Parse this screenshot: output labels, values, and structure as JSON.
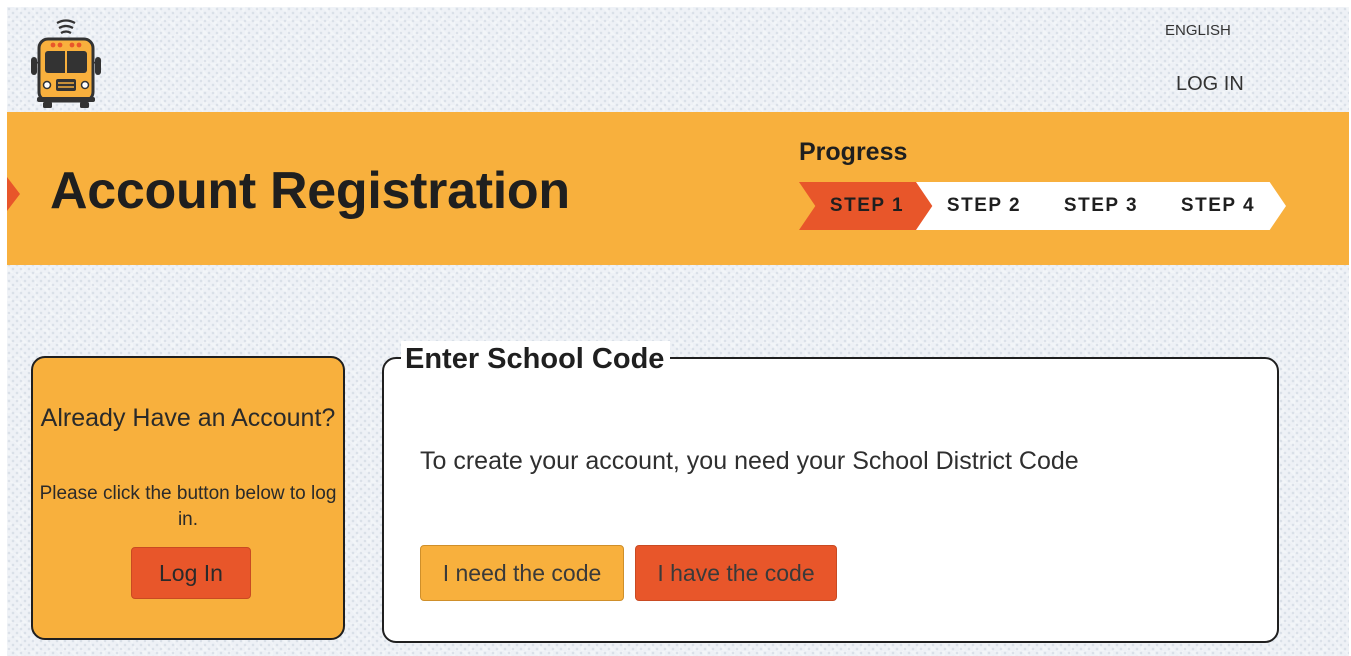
{
  "header": {
    "logo_icon": "school-bus-icon",
    "language_label": "ENGLISH",
    "login_label": "LOG IN"
  },
  "banner": {
    "title": "Account Registration",
    "progress_label": "Progress",
    "current_step": 1,
    "steps": [
      {
        "label": "STEP 1"
      },
      {
        "label": "STEP 2"
      },
      {
        "label": "STEP 3"
      },
      {
        "label": "STEP 4"
      }
    ]
  },
  "login_card": {
    "title": "Already Have an Account?",
    "text": "Please click the button below to log in.",
    "button_label": "Log In"
  },
  "code_panel": {
    "legend": "Enter School Code",
    "description": "To create your account, you need your School District Code",
    "need_code_label": "I need the code",
    "have_code_label": "I have the code"
  },
  "colors": {
    "brand_yellow": "#f8b03d",
    "brand_orange": "#e8562a",
    "text_dark": "#1f1f1f"
  }
}
